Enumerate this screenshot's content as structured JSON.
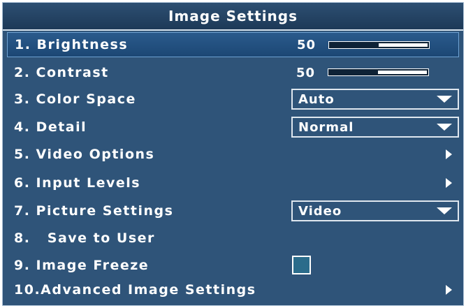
{
  "title": "Image Settings",
  "rows": [
    {
      "label": "1. Brightness",
      "value": "50",
      "level_fraction": 0.5
    },
    {
      "label": "2. Contrast",
      "value": "50",
      "level_fraction": 0.5
    },
    {
      "label": "3. Color Space",
      "dropdown_value": "Auto"
    },
    {
      "label": "4. Detail",
      "dropdown_value": "Normal"
    },
    {
      "label": "5. Video Options"
    },
    {
      "label": "6. Input Levels"
    },
    {
      "label": "7. Picture Settings",
      "dropdown_value": "Video"
    },
    {
      "label": "8.   Save to User"
    },
    {
      "label": "9. Image Freeze",
      "checked": false
    },
    {
      "label": "10.Advanced Image Settings"
    }
  ],
  "selected_row": "1. Brightness",
  "colors": {
    "panel": "#2f5479",
    "selected_row": "#1f4c7a",
    "text": "#ffffff"
  }
}
